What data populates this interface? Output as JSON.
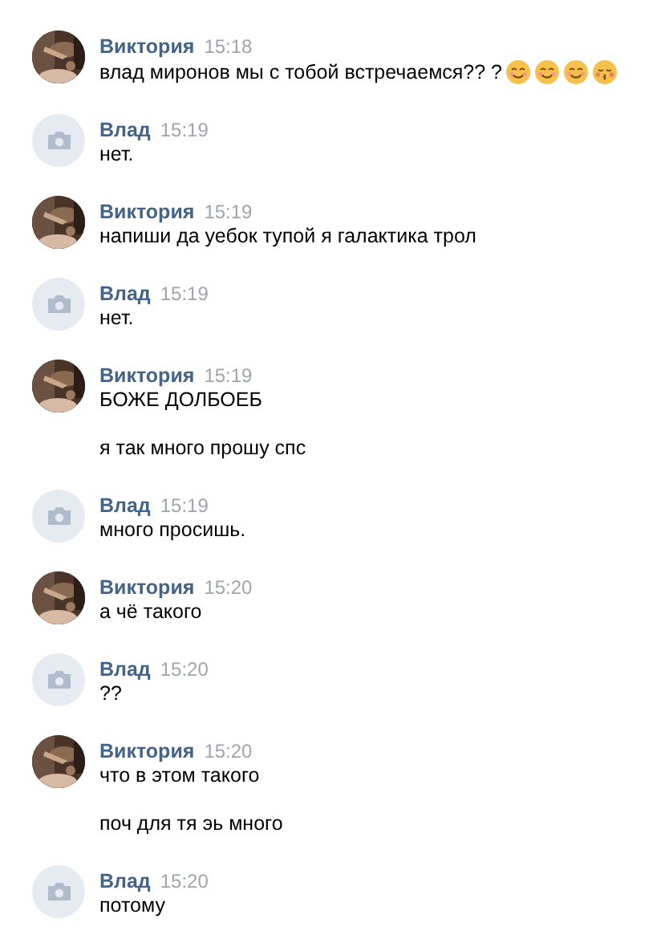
{
  "messages": [
    {
      "sender": "Виктория",
      "avatar": {
        "kind": "picture"
      },
      "time": "15:18",
      "texts": [
        {
          "text": "влад миронов мы с тобой встречаемся?? ?",
          "emoji": [
            {
              "kind": "smile"
            },
            {
              "kind": "smile"
            },
            {
              "kind": "smile"
            },
            {
              "kind": "kiss"
            }
          ]
        }
      ]
    },
    {
      "sender": "Влад",
      "avatar": {
        "kind": "camera"
      },
      "time": "15:19",
      "texts": [
        {
          "text": "нет."
        }
      ]
    },
    {
      "sender": "Виктория",
      "avatar": {
        "kind": "picture"
      },
      "time": "15:19",
      "texts": [
        {
          "text": "напиши да уебок тупой я галактика трол"
        }
      ]
    },
    {
      "sender": "Влад",
      "avatar": {
        "kind": "camera"
      },
      "time": "15:19",
      "texts": [
        {
          "text": "нет."
        }
      ]
    },
    {
      "sender": "Виктория",
      "avatar": {
        "kind": "picture"
      },
      "time": "15:19",
      "texts": [
        {
          "text": "БОЖЕ ДОЛБОЕБ"
        },
        {
          "text": "я так много прошу спс"
        }
      ]
    },
    {
      "sender": "Влад",
      "avatar": {
        "kind": "camera"
      },
      "time": "15:19",
      "texts": [
        {
          "text": "много просишь."
        }
      ]
    },
    {
      "sender": "Виктория",
      "avatar": {
        "kind": "picture"
      },
      "time": "15:20",
      "texts": [
        {
          "text": "а чё такого"
        }
      ]
    },
    {
      "sender": "Влад",
      "avatar": {
        "kind": "camera"
      },
      "time": "15:20",
      "texts": [
        {
          "text": "??"
        }
      ]
    },
    {
      "sender": "Виктория",
      "avatar": {
        "kind": "picture"
      },
      "time": "15:20",
      "texts": [
        {
          "text": "что в этом такого"
        },
        {
          "text": "поч для тя эь много"
        }
      ]
    },
    {
      "sender": "Влад",
      "avatar": {
        "kind": "camera"
      },
      "time": "15:20",
      "texts": [
        {
          "text": "потому"
        }
      ]
    }
  ]
}
